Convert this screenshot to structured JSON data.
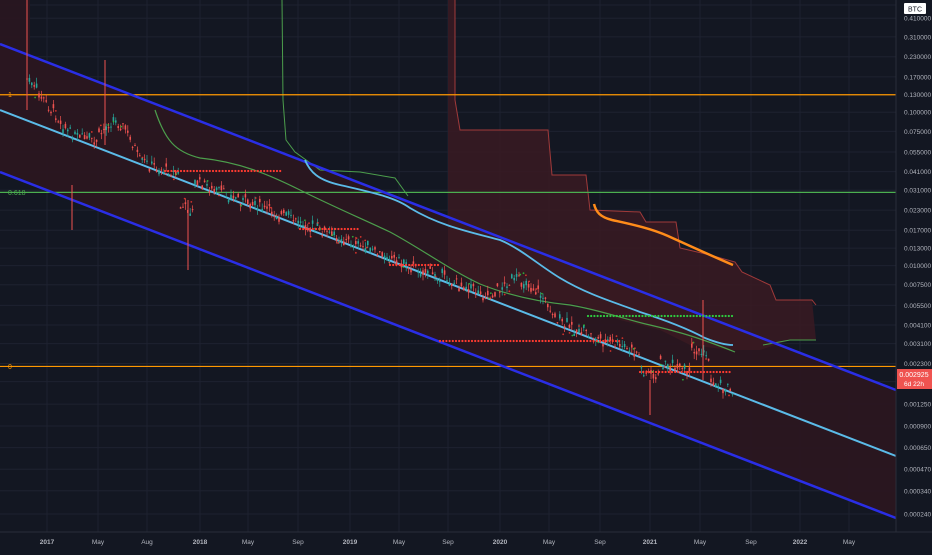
{
  "colors": {
    "background": "#131722",
    "grid": "#1e2230",
    "axis_text": "#b2b5be",
    "fib_line": "#ff9800",
    "fib_green": "#4caf50",
    "channel_blue": "#2a2ee6",
    "midline": "#5bbbe8",
    "ma_green": "#4c9e4c",
    "cloud_red": "#a13a3a",
    "cloud_fill": "#3a1a22",
    "orange_curve": "#ff8c1a",
    "candle_up": "#26a69a",
    "candle_down": "#ef5350",
    "td_green": "#2ecc40",
    "td_red": "#ff3b30",
    "price_tag": "#ef5350",
    "axis_badge": "#ffffff"
  },
  "chart_data": {
    "type": "line",
    "symbol_label": "BTC",
    "price_axis": {
      "scale": "log",
      "tick_labels": [
        "0.5",
        "0.410000",
        "0.310000",
        "0.230000",
        "0.170000",
        "0.130000",
        "0.100000",
        "0.075000",
        "0.055000",
        "0.041000",
        "0.031000",
        "0.023000",
        "0.017000",
        "0.013000",
        "0.010000",
        "0.007500",
        "0.005500",
        "0.004100",
        "0.003100",
        "0.002300",
        "0.001750",
        "0.001250",
        "0.000900",
        "0.000650",
        "0.000470",
        "0.000340",
        "0.000240"
      ]
    },
    "time_axis": {
      "tick_labels": [
        "2017",
        "May",
        "Aug",
        "2018",
        "May",
        "Sep",
        "2019",
        "May",
        "Sep",
        "2020",
        "May",
        "Sep",
        "2021",
        "May",
        "Sep",
        "2022",
        "May"
      ]
    },
    "fib_levels": [
      {
        "label": "1",
        "value": 0.13
      },
      {
        "label": "0.618",
        "value": 0.03
      },
      {
        "label": "0",
        "value": 0.0022
      }
    ],
    "current_price": {
      "value": "0.002925",
      "countdown": "6d 22h"
    }
  }
}
